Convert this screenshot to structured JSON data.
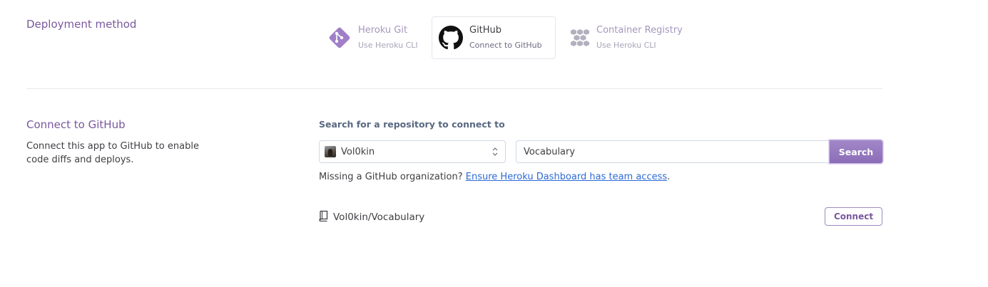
{
  "deployment": {
    "title": "Deployment method",
    "methods": [
      {
        "name": "Heroku Git",
        "sub": "Use Heroku CLI",
        "icon": "git-icon",
        "selected": false
      },
      {
        "name": "GitHub",
        "sub": "Connect to GitHub",
        "icon": "github-icon",
        "selected": true
      },
      {
        "name": "Container Registry",
        "sub": "Use Heroku CLI",
        "icon": "container-icon",
        "selected": false
      }
    ]
  },
  "connect": {
    "title": "Connect to GitHub",
    "description": "Connect this app to GitHub to enable code diffs and deploys.",
    "search_label": "Search for a repository to connect to",
    "owner_select": "Vol0kin",
    "repo_input_value": "Vocabulary",
    "search_button": "Search",
    "missing_text": "Missing a GitHub organization? ",
    "missing_link": "Ensure Heroku Dashboard has team access",
    "missing_suffix": ".",
    "result_repo": "Vol0kin/Vocabulary",
    "connect_button": "Connect"
  },
  "colors": {
    "accent": "#79589f",
    "button_purple": "#9473c0",
    "link_blue": "#2d6ad6"
  }
}
